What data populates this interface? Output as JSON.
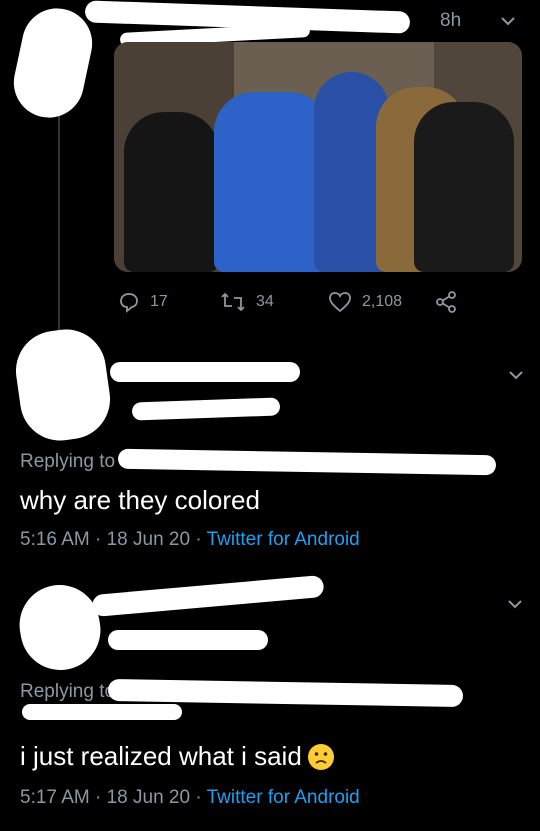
{
  "tweet1": {
    "time": "8h",
    "stats": {
      "replies": "17",
      "retweets": "34",
      "likes": "2,108"
    }
  },
  "reply1": {
    "replying_to_label": "Replying to",
    "text": "why are they colored",
    "meta": {
      "time": "5:16 AM",
      "sep": "·",
      "date": "18 Jun 20",
      "client": "Twitter for Android"
    }
  },
  "reply2": {
    "replying_to_label": "Replying to",
    "text": "i just realized what i said",
    "emoji": "slightly-frowning-face",
    "meta": {
      "time": "5:17 AM",
      "sep": "·",
      "date": "18 Jun 20",
      "client": "Twitter for Android"
    }
  },
  "colors": {
    "background": "#000000",
    "muted": "#8b98a5",
    "link": "#1da1f2"
  }
}
